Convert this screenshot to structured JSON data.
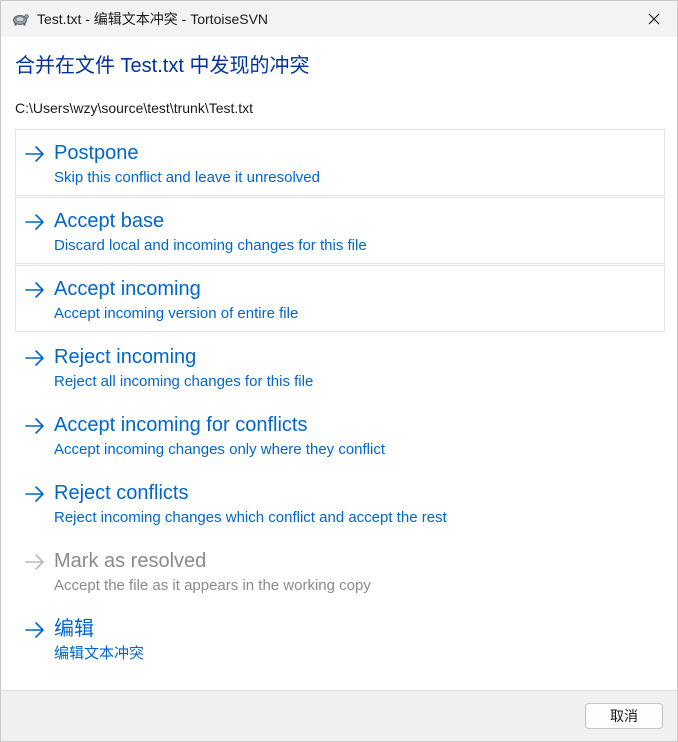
{
  "window": {
    "title": "Test.txt - 编辑文本冲突 - TortoiseSVN"
  },
  "heading": "合并在文件 Test.txt 中发现的冲突",
  "file_path": "C:\\Users\\wzy\\source\\test\\trunk\\Test.txt",
  "options": [
    {
      "title": "Postpone",
      "description": "Skip this conflict and leave it unresolved",
      "enabled": true
    },
    {
      "title": "Accept base",
      "description": "Discard local and incoming changes for this file",
      "enabled": true
    },
    {
      "title": "Accept incoming",
      "description": "Accept incoming version of entire file",
      "enabled": true
    },
    {
      "title": "Reject incoming",
      "description": "Reject all incoming changes for this file",
      "enabled": true
    },
    {
      "title": "Accept incoming for conflicts",
      "description": "Accept incoming changes only where they conflict",
      "enabled": true
    },
    {
      "title": "Reject conflicts",
      "description": "Reject incoming changes which conflict and accept the rest",
      "enabled": true
    },
    {
      "title": "Mark as resolved",
      "description": "Accept the file as it appears in the working copy",
      "enabled": false
    },
    {
      "title": "编辑",
      "description": "编辑文本冲突",
      "enabled": true
    }
  ],
  "footer": {
    "cancel_label": "取消"
  },
  "colors": {
    "link": "#0066cc",
    "heading": "#003399",
    "disabled": "#8a8a8a"
  },
  "icons": {
    "app": "tortoise-icon",
    "close": "close-icon",
    "option": "arrow-right-icon"
  }
}
